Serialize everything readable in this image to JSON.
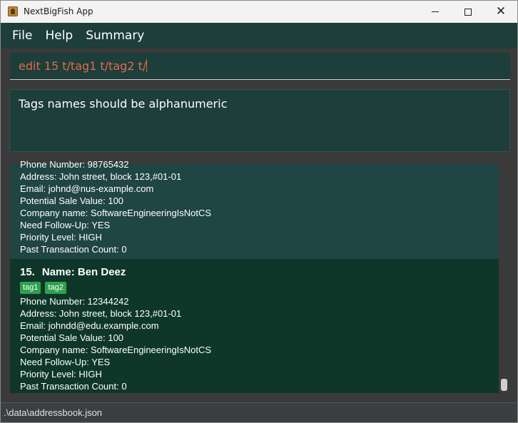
{
  "window": {
    "title": "NextBigFish App"
  },
  "menu": {
    "file": "File",
    "help": "Help",
    "summary": "Summary"
  },
  "command": {
    "value": "edit 15 t/tag1 t/tag2 t/"
  },
  "result": {
    "message": "Tags names should be alphanumeric"
  },
  "list": {
    "partial_card": {
      "phone": "Phone Number: 98765432",
      "address": "Address: John street, block 123,#01-01",
      "email": "Email: johnd@nus-example.com",
      "potential_sale": "Potential Sale Value: 100",
      "company": "Company name: SoftwareEngineeringIsNotCS",
      "follow_up": "Need Follow-Up: YES",
      "priority": "Priority Level: HIGH",
      "transactions": "Past Transaction Count: 0"
    },
    "selected_card": {
      "index": "15.",
      "name": "Name: Ben Deez",
      "tags": [
        "tag1",
        "tag2"
      ],
      "phone": "Phone Number: 12344242",
      "address": "Address: John street, block 123,#01-01",
      "email": "Email: johndd@edu.example.com",
      "potential_sale": "Potential Sale Value: 100",
      "company": "Company name: SoftwareEngineeringIsNotCS",
      "follow_up": "Need Follow-Up: YES",
      "priority": "Priority Level: HIGH",
      "transactions": "Past Transaction Count: 0"
    }
  },
  "status": {
    "file_path": ".\\data\\addressbook.json"
  },
  "icons": {
    "app": "fish-app-icon",
    "minimize": "minimize-icon",
    "maximize": "maximize-icon",
    "close": "close-icon"
  },
  "colors": {
    "panel": "#1d3e3b",
    "selected_card": "#0e3729",
    "card": "#1f4544",
    "command_text": "#e46a4a",
    "tag": "#2ea14f"
  }
}
